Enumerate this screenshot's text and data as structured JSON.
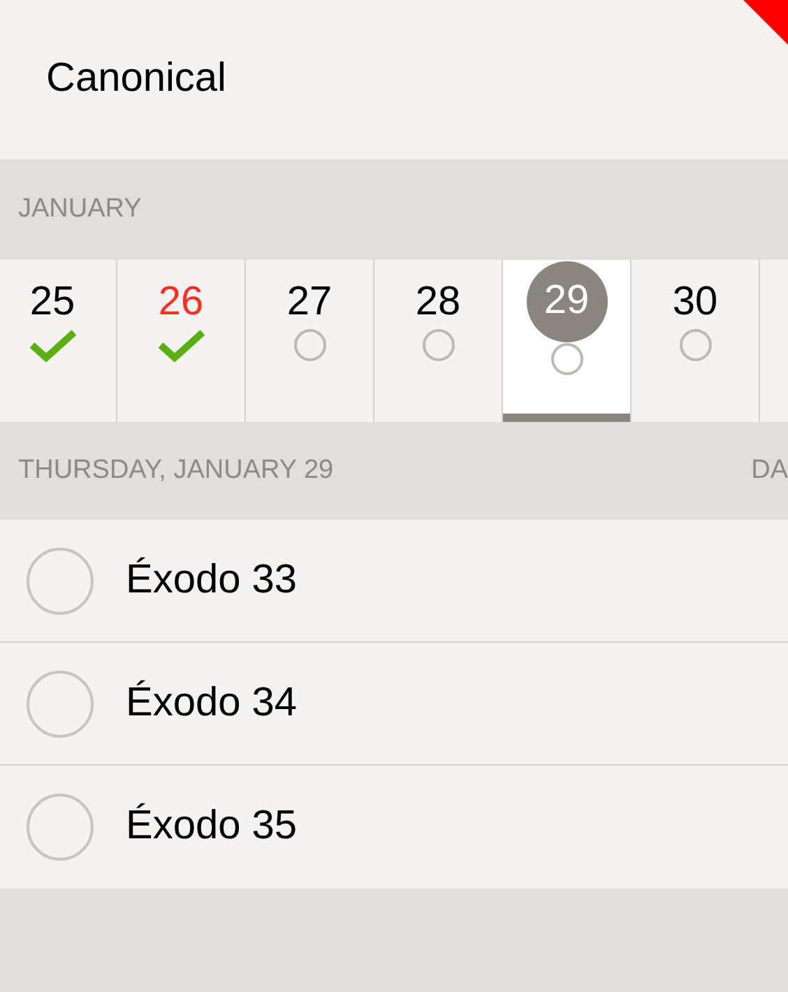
{
  "title": "Canonical",
  "month": "JANUARY",
  "days": [
    {
      "number": "25",
      "done": true,
      "today": false,
      "selected": false
    },
    {
      "number": "26",
      "done": true,
      "today": true,
      "selected": false
    },
    {
      "number": "27",
      "done": false,
      "today": false,
      "selected": false
    },
    {
      "number": "28",
      "done": false,
      "today": false,
      "selected": false
    },
    {
      "number": "29",
      "done": false,
      "today": false,
      "selected": true
    },
    {
      "number": "30",
      "done": false,
      "today": false,
      "selected": false
    }
  ],
  "date_header": {
    "label": "THURSDAY, JANUARY 29",
    "right_label": "DA"
  },
  "readings": [
    {
      "title": "Éxodo 33",
      "checked": false
    },
    {
      "title": "Éxodo 34",
      "checked": false
    },
    {
      "title": "Éxodo 35",
      "checked": false
    }
  ]
}
